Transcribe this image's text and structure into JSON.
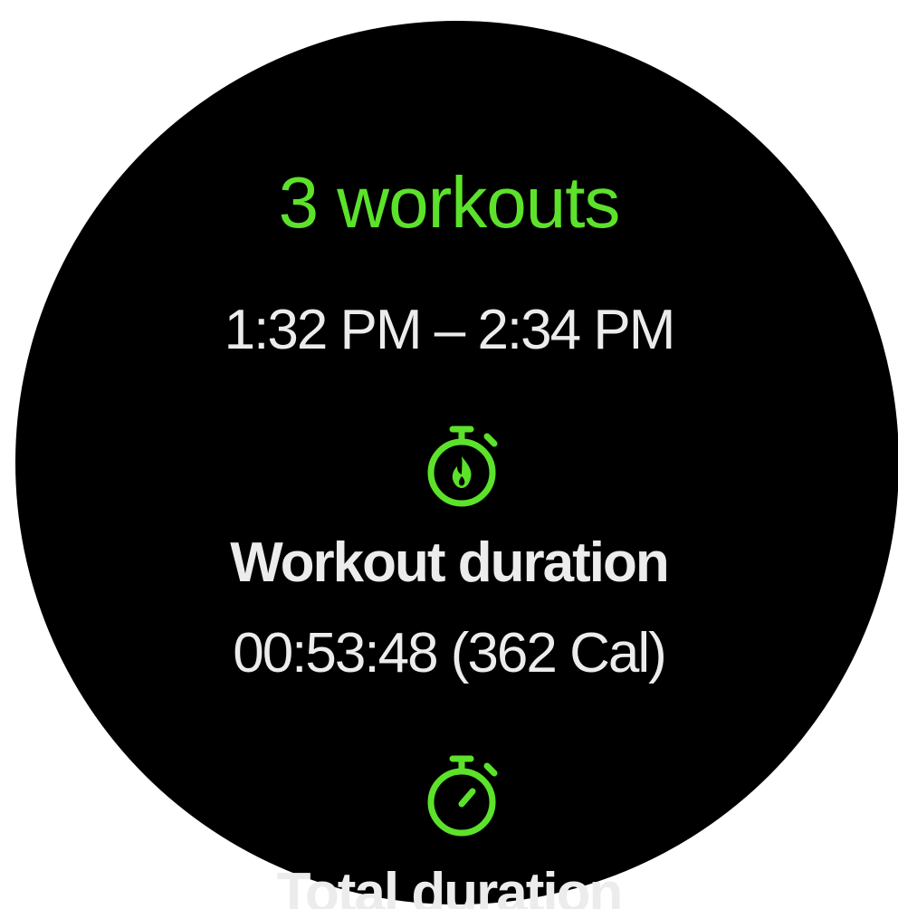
{
  "summary": {
    "title": "3 workouts",
    "time_range": "1:32 PM – 2:34 PM"
  },
  "stats": [
    {
      "icon": "stopwatch-flame-icon",
      "label": "Workout duration",
      "value": "00:53:48 (362 Cal)"
    },
    {
      "icon": "stopwatch-icon",
      "label": "Total duration"
    }
  ],
  "colors": {
    "accent": "#5ce22a",
    "text": "#ececec",
    "background": "#000000"
  }
}
